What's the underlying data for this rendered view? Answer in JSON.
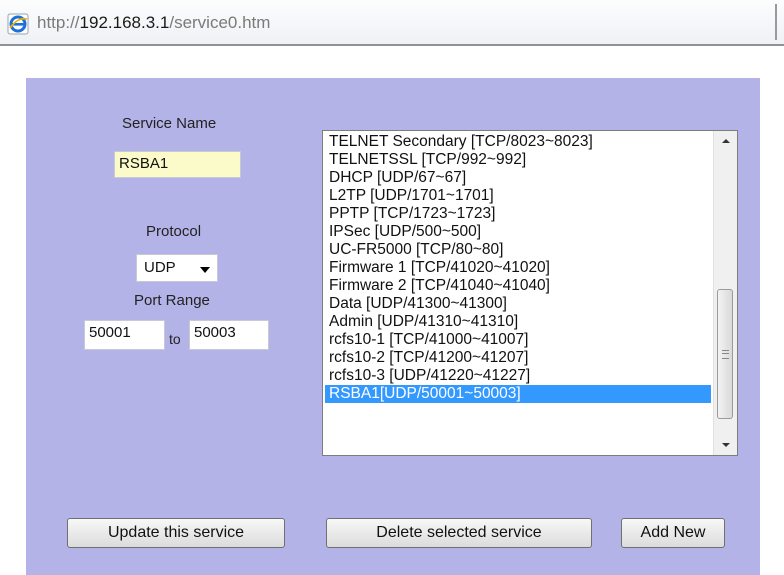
{
  "browser": {
    "url_prefix": "http://",
    "url_host": "192.168.3.1",
    "url_path": "/service0.htm",
    "icon": "ie-page-icon"
  },
  "form": {
    "service_name_label": "Service Name",
    "service_name_value": "RSBA1",
    "protocol_label": "Protocol",
    "protocol_value": "UDP",
    "port_range_label": "Port Range",
    "port_from": "50001",
    "to_label": "to",
    "port_to": "50003"
  },
  "services": [
    "TELNET Secondary [TCP/8023~8023]",
    "TELNETSSL [TCP/992~992]",
    "DHCP [UDP/67~67]",
    "L2TP [UDP/1701~1701]",
    "PPTP [TCP/1723~1723]",
    "IPSec [UDP/500~500]",
    "UC-FR5000 [TCP/80~80]",
    "Firmware 1 [TCP/41020~41020]",
    "Firmware 2 [TCP/41040~41040]",
    "Data [UDP/41300~41300]",
    "Admin [UDP/41310~41310]",
    "rcfs10-1 [TCP/41000~41007]",
    "rcfs10-2 [TCP/41200~41207]",
    "rcfs10-3 [UDP/41220~41227]",
    "RSBA1[UDP/50001~50003]"
  ],
  "selected_index": 14,
  "buttons": {
    "update": "Update this service",
    "delete": "Delete selected service",
    "add": "Add New"
  },
  "colors": {
    "panel": "#b4b3e8",
    "selection": "#3399ff",
    "name_field": "#fbfbc9"
  }
}
